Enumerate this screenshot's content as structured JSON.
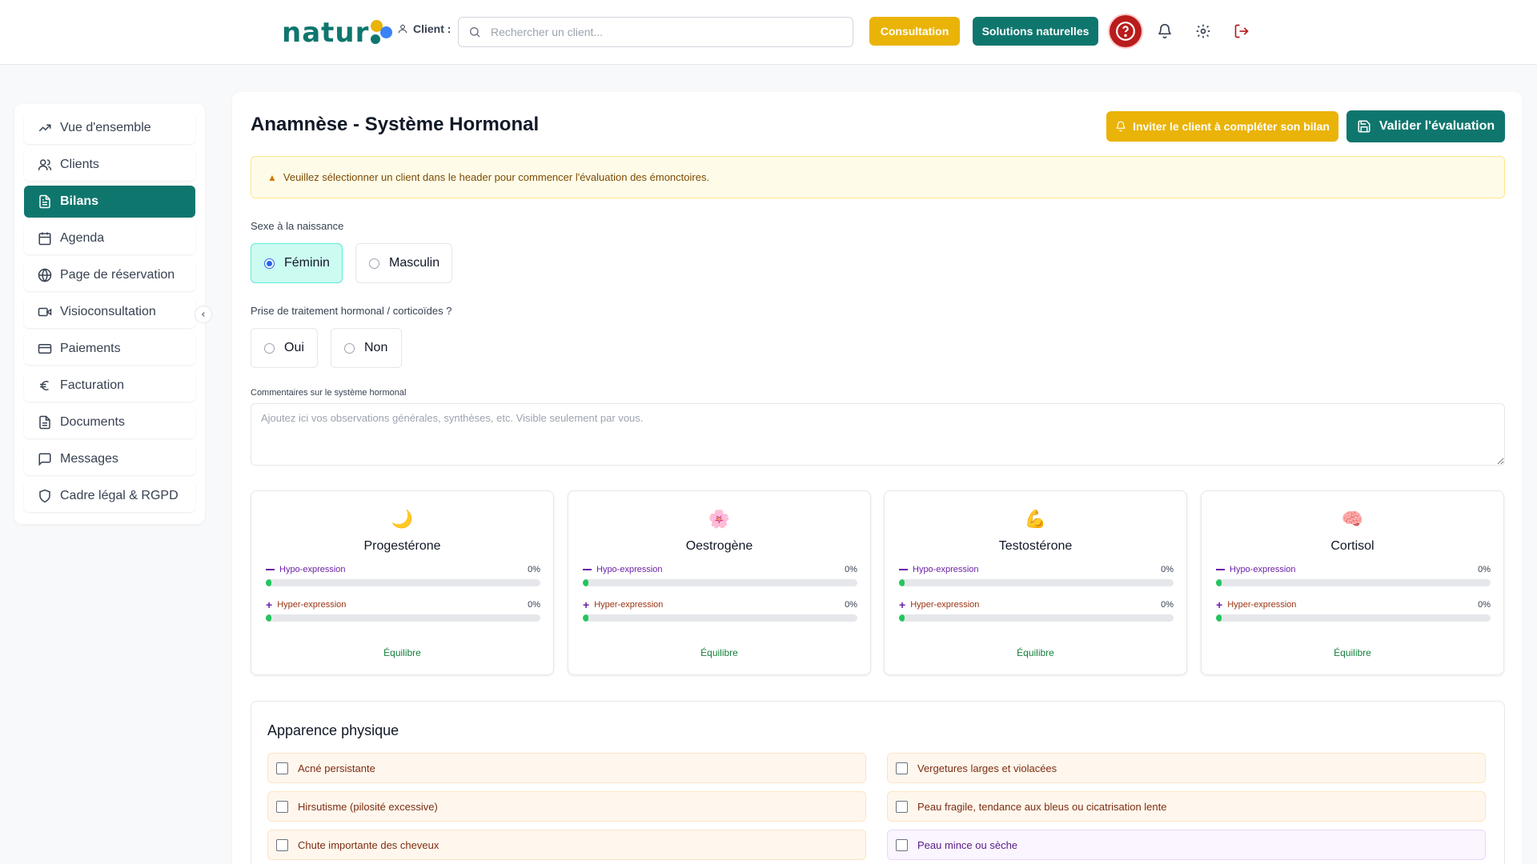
{
  "header": {
    "logo_text": "natur",
    "client_label": "Client :",
    "search_placeholder": "Rechercher un client...",
    "consultation_label": "Consultation",
    "solutions_label": "Solutions naturelles"
  },
  "sidebar": {
    "items": [
      {
        "label": "Vue d'ensemble",
        "icon": "trending-up-icon"
      },
      {
        "label": "Clients",
        "icon": "users-icon"
      },
      {
        "label": "Bilans",
        "icon": "document-icon",
        "active": true
      },
      {
        "label": "Agenda",
        "icon": "calendar-icon"
      },
      {
        "label": "Page de réservation",
        "icon": "globe-icon"
      },
      {
        "label": "Visioconsultation",
        "icon": "video-icon"
      },
      {
        "label": "Paiements",
        "icon": "credit-card-icon"
      },
      {
        "label": "Facturation",
        "icon": "euro-icon"
      },
      {
        "label": "Documents",
        "icon": "file-icon"
      },
      {
        "label": "Messages",
        "icon": "message-icon"
      },
      {
        "label": "Cadre légal & RGPD",
        "icon": "shield-icon"
      }
    ]
  },
  "main": {
    "title": "Anamnèse - Système Hormonal",
    "invite_label": "Inviter le client à compléter son bilan",
    "validate_label": "Valider l'évaluation",
    "alert": "Veuillez sélectionner un client dans le header pour commencer l'évaluation des émonctoires.",
    "sex_label": "Sexe à la naissance",
    "sex_options": [
      {
        "label": "Féminin",
        "selected": true
      },
      {
        "label": "Masculin",
        "selected": false
      }
    ],
    "treatment_label": "Prise de traitement hormonal / corticoïdes ?",
    "treatment_options": [
      {
        "label": "Oui",
        "selected": false
      },
      {
        "label": "Non",
        "selected": false
      }
    ],
    "comments_label": "Commentaires sur le système hormonal",
    "comments_placeholder": "Ajoutez ici vos observations générales, synthèses, etc. Visible seulement par vous."
  },
  "hormones": [
    {
      "emoji": "🌙",
      "name": "Progestérone",
      "hypo_label": "Hypo-expression",
      "hypo_value": "0%",
      "hyper_label": "Hyper-expression",
      "hyper_value": "0%",
      "state": "Équilibre"
    },
    {
      "emoji": "🌸",
      "name": "Oestrogène",
      "hypo_label": "Hypo-expression",
      "hypo_value": "0%",
      "hyper_label": "Hyper-expression",
      "hyper_value": "0%",
      "state": "Équilibre"
    },
    {
      "emoji": "💪",
      "name": "Testostérone",
      "hypo_label": "Hypo-expression",
      "hypo_value": "0%",
      "hyper_label": "Hyper-expression",
      "hyper_value": "0%",
      "state": "Équilibre"
    },
    {
      "emoji": "🧠",
      "name": "Cortisol",
      "hypo_label": "Hypo-expression",
      "hypo_value": "0%",
      "hyper_label": "Hyper-expression",
      "hyper_value": "0%",
      "state": "Équilibre"
    }
  ],
  "appearance": {
    "title": "Apparence physique",
    "items": [
      "Acné persistante",
      "Vergetures larges et violacées",
      "Hirsutisme (pilosité excessive)",
      "Peau fragile, tendance aux bleus ou cicatrisation lente",
      "Chute importante des cheveux",
      "Peau mince ou sèche"
    ]
  },
  "colors": {
    "primary": "#0f766e",
    "accent": "#eab308",
    "danger": "#b91c1c",
    "hypo": "#6b21a8",
    "hyper": "#9a3412",
    "balance": "#22c55e"
  }
}
